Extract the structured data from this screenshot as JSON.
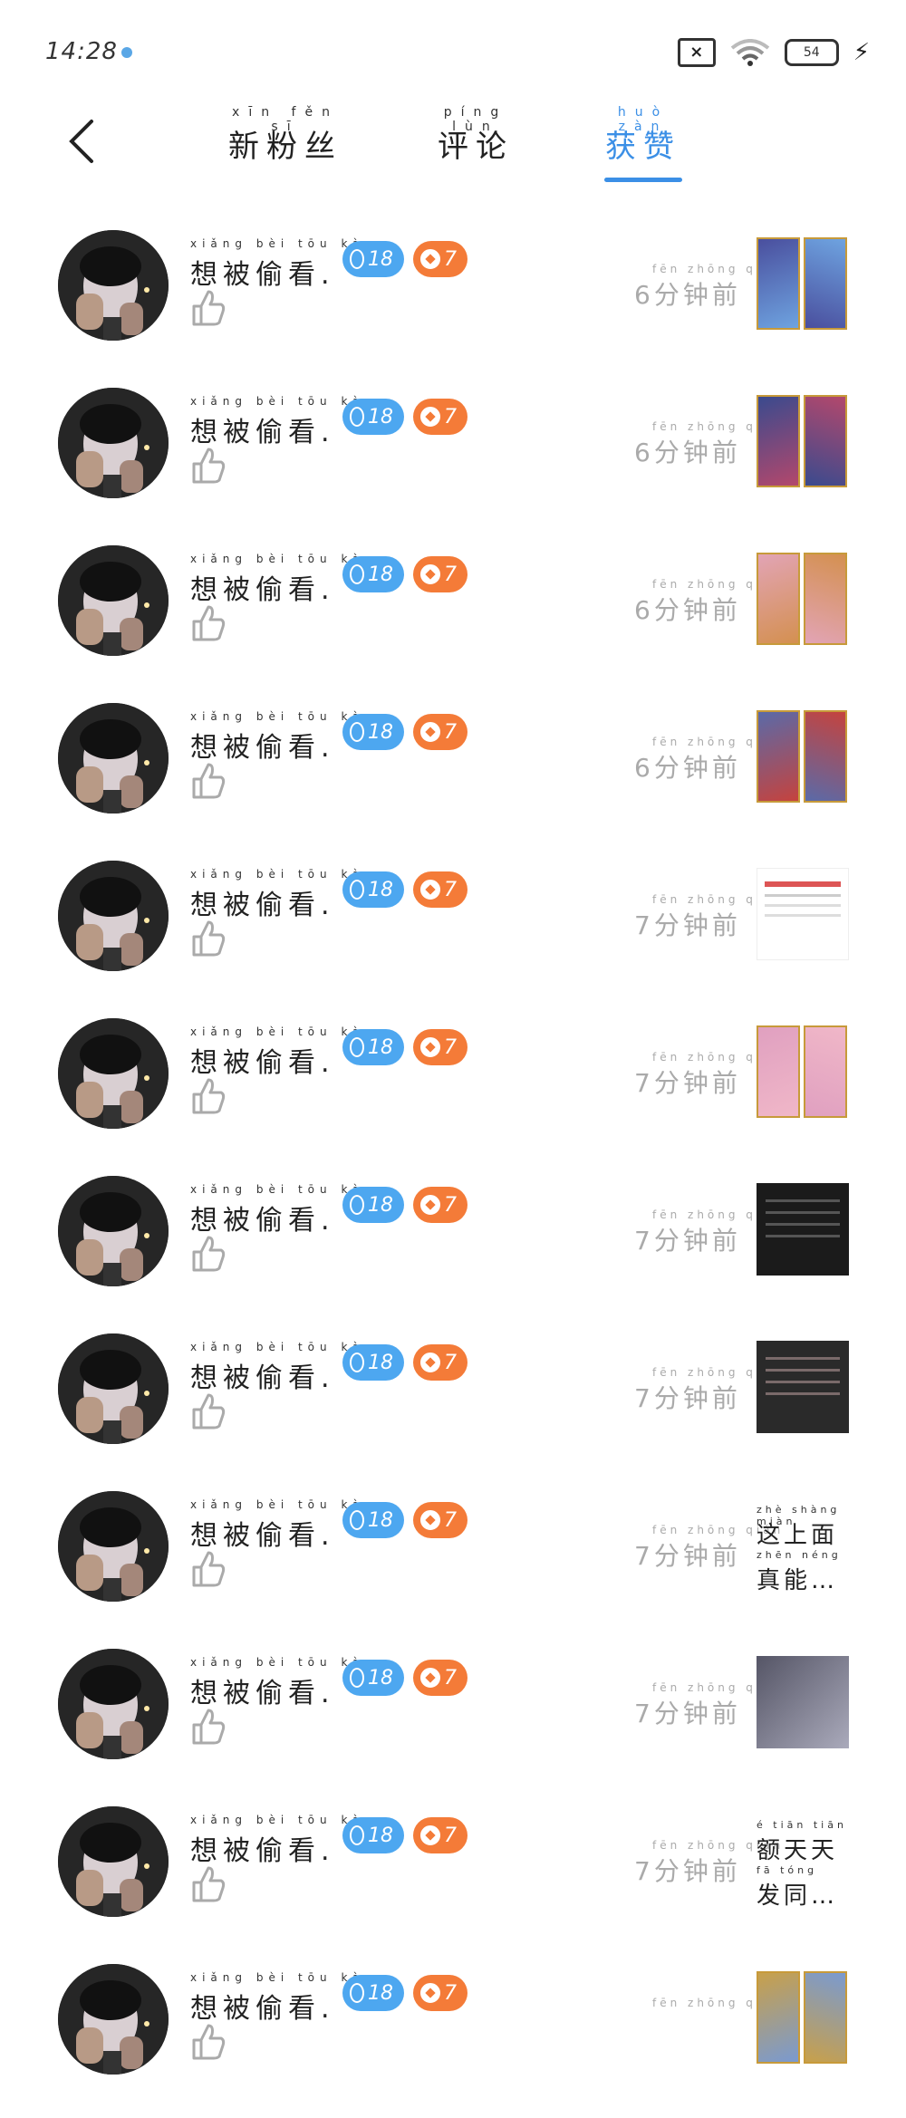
{
  "status_bar": {
    "time": "14:28",
    "battery": "54"
  },
  "header": {
    "tabs": [
      {
        "pinyin": "xīn fěn sī",
        "label": "新粉丝"
      },
      {
        "pinyin": "píng lùn",
        "label": "评论"
      },
      {
        "pinyin": "huò zàn",
        "label": "获赞"
      }
    ]
  },
  "list": [
    {
      "name_pinyin": "xiǎng bèi tōu kàn",
      "name": "想被偷看.",
      "level": "18",
      "fire": "7",
      "time_pinyin": "fēn zhōng qián",
      "time": "6分钟前",
      "thumb": "cards",
      "colors": [
        "#4a4f9e",
        "#6ea3e0"
      ]
    },
    {
      "name_pinyin": "xiǎng bèi tōu kàn",
      "name": "想被偷看.",
      "level": "18",
      "fire": "7",
      "time_pinyin": "fēn zhōng qián",
      "time": "6分钟前",
      "thumb": "cards",
      "colors": [
        "#3a4a8e",
        "#b3486c"
      ]
    },
    {
      "name_pinyin": "xiǎng bèi tōu kàn",
      "name": "想被偷看.",
      "level": "18",
      "fire": "7",
      "time_pinyin": "fēn zhōng qián",
      "time": "6分钟前",
      "thumb": "cards",
      "colors": [
        "#e2a4b5",
        "#d49050"
      ]
    },
    {
      "name_pinyin": "xiǎng bèi tōu kàn",
      "name": "想被偷看.",
      "level": "18",
      "fire": "7",
      "time_pinyin": "fēn zhōng qián",
      "time": "6分钟前",
      "thumb": "cards",
      "colors": [
        "#5a6aa8",
        "#c5433e"
      ]
    },
    {
      "name_pinyin": "xiǎng bèi tōu kàn",
      "name": "想被偷看.",
      "level": "18",
      "fire": "7",
      "time_pinyin": "fēn zhōng qián",
      "time": "7分钟前",
      "thumb": "doc",
      "colors": [
        "#ffffff",
        "#d55"
      ]
    },
    {
      "name_pinyin": "xiǎng bèi tōu kàn",
      "name": "想被偷看.",
      "level": "18",
      "fire": "7",
      "time_pinyin": "fēn zhōng qián",
      "time": "7分钟前",
      "thumb": "cards",
      "colors": [
        "#e0a0c0",
        "#f0b7c8"
      ]
    },
    {
      "name_pinyin": "xiǎng bèi tōu kàn",
      "name": "想被偷看.",
      "level": "18",
      "fire": "7",
      "time_pinyin": "fēn zhōng qián",
      "time": "7分钟前",
      "thumb": "dark",
      "colors": [
        "#1b1b1b",
        "#555"
      ]
    },
    {
      "name_pinyin": "xiǎng bèi tōu kàn",
      "name": "想被偷看.",
      "level": "18",
      "fire": "7",
      "time_pinyin": "fēn zhōng qián",
      "time": "7分钟前",
      "thumb": "dark",
      "colors": [
        "#2a2a2a",
        "#7a6a6a"
      ]
    },
    {
      "name_pinyin": "xiǎng bèi tōu kàn",
      "name": "想被偷看.",
      "level": "18",
      "fire": "7",
      "time_pinyin": "fēn zhōng qián",
      "time": "7分钟前",
      "thumb": "text",
      "text_lines": [
        {
          "pinyin": "zhè shàng miàn",
          "text": "这上面"
        },
        {
          "pinyin": "zhēn néng",
          "text": "真能…"
        }
      ]
    },
    {
      "name_pinyin": "xiǎng bèi tōu kàn",
      "name": "想被偷看.",
      "level": "18",
      "fire": "7",
      "time_pinyin": "fēn zhōng qián",
      "time": "7分钟前",
      "thumb": "photo",
      "colors": [
        "#556",
        "#aab"
      ]
    },
    {
      "name_pinyin": "xiǎng bèi tōu kàn",
      "name": "想被偷看.",
      "level": "18",
      "fire": "7",
      "time_pinyin": "fēn zhōng qián",
      "time": "7分钟前",
      "thumb": "text",
      "text_lines": [
        {
          "pinyin": "é tiān tiān",
          "text": "额天天"
        },
        {
          "pinyin": "fā tóng",
          "text": "发同…"
        }
      ]
    },
    {
      "name_pinyin": "xiǎng bèi tōu kàn",
      "name": "想被偷看.",
      "level": "18",
      "fire": "7",
      "time_pinyin": "fēn zhōng qián",
      "time": "",
      "thumb": "cards",
      "colors": [
        "#c8a04a",
        "#7a9ad0"
      ]
    }
  ]
}
